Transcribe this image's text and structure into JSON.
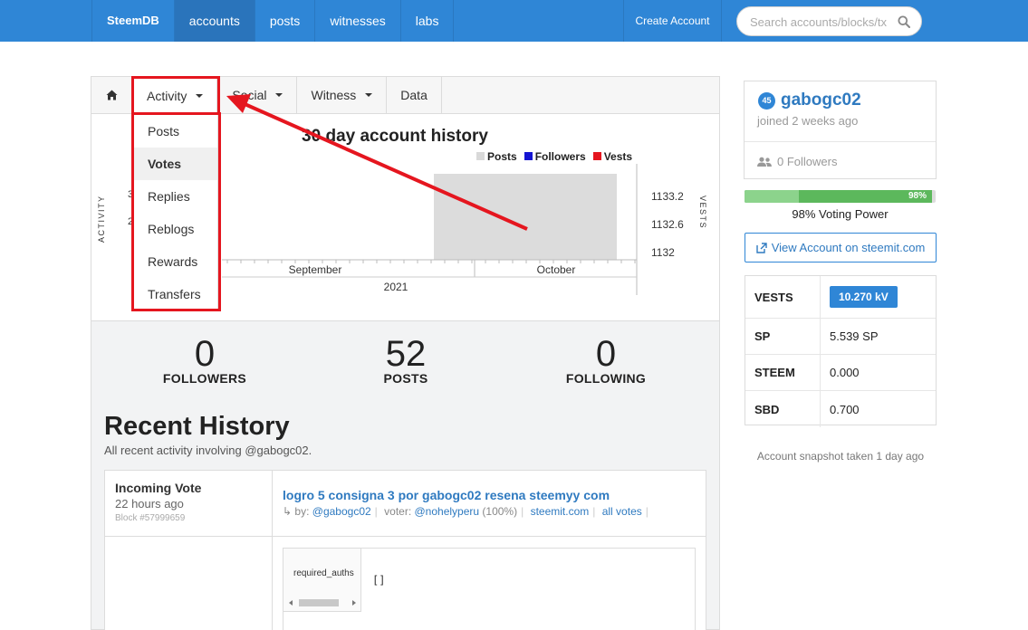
{
  "navbar": {
    "brand": "SteemDB",
    "items": [
      {
        "label": "accounts",
        "active": true
      },
      {
        "label": "posts",
        "active": false
      },
      {
        "label": "witnesses",
        "active": false
      },
      {
        "label": "labs",
        "active": false
      }
    ],
    "create_account": "Create Account",
    "search_placeholder": "Search accounts/blocks/tx"
  },
  "tabs": {
    "home_icon": "home-icon",
    "activity": "Activity",
    "social": "Social",
    "witness": "Witness",
    "data": "Data"
  },
  "dropdown": {
    "items": [
      {
        "label": "Posts",
        "active": false
      },
      {
        "label": "Votes",
        "active": true
      },
      {
        "label": "Replies",
        "active": false
      },
      {
        "label": "Reblogs",
        "active": false
      },
      {
        "label": "Rewards",
        "active": false
      },
      {
        "label": "Transfers",
        "active": false
      }
    ]
  },
  "chart_data": {
    "type": "bar",
    "title": "30 day account history",
    "legend": [
      {
        "name": "Posts",
        "color": "#d9d9d9"
      },
      {
        "name": "Followers",
        "color": "#1414d2"
      },
      {
        "name": "Vests",
        "color": "#e5161f"
      }
    ],
    "ylabel_left": "ACTIVITY",
    "ylabel_right": "VESTS",
    "left_ticks": [
      "3",
      "2"
    ],
    "right_ticks": [
      "1133.2",
      "1132.6",
      "1132"
    ],
    "x_month_labels": [
      "September",
      "October"
    ],
    "x_year_label": "2021",
    "legend_position": "top-right"
  },
  "stats": {
    "followers": {
      "value": "0",
      "label": "FOLLOWERS"
    },
    "posts": {
      "value": "52",
      "label": "POSTS"
    },
    "following": {
      "value": "0",
      "label": "FOLLOWING"
    }
  },
  "recent": {
    "title": "Recent History",
    "subtitle": "All recent activity involving @gabogc02."
  },
  "history": {
    "type": "Incoming Vote",
    "time": "22 hours ago",
    "block": "Block #57999659",
    "link": "logro 5 consigna 3 por gabogc02 resena steemyy com",
    "by_prefix": "by:",
    "by_user": "@gabogc02",
    "voter_prefix": "voter:",
    "voter_user": "@nohelyperu",
    "voter_pct": "(100%)",
    "steemit_link": "steemit.com",
    "all_votes": "all votes",
    "json_key": "required_auths",
    "json_value": "[]"
  },
  "profile": {
    "reputation": "45",
    "username": "gabogc02",
    "joined": "joined 2 weeks ago",
    "followers": "0 Followers"
  },
  "voting_power": {
    "percent": 98,
    "bar_label": "98%",
    "label": "98% Voting Power"
  },
  "view_account": "View Account on steemit.com",
  "wallet": [
    {
      "label": "VESTS",
      "value": "10.270 kV",
      "badge": true
    },
    {
      "label": "SP",
      "value": "5.539 SP",
      "badge": false
    },
    {
      "label": "STEEM",
      "value": "0.000",
      "badge": false
    },
    {
      "label": "SBD",
      "value": "0.700",
      "badge": false
    }
  ],
  "snapshot": "Account snapshot taken 1 day ago",
  "colors": {
    "nav_blue": "#2f86d6",
    "link_blue": "#2f7ac0",
    "annotation_red": "#e5161f",
    "vp_green": "#5cb85c"
  }
}
